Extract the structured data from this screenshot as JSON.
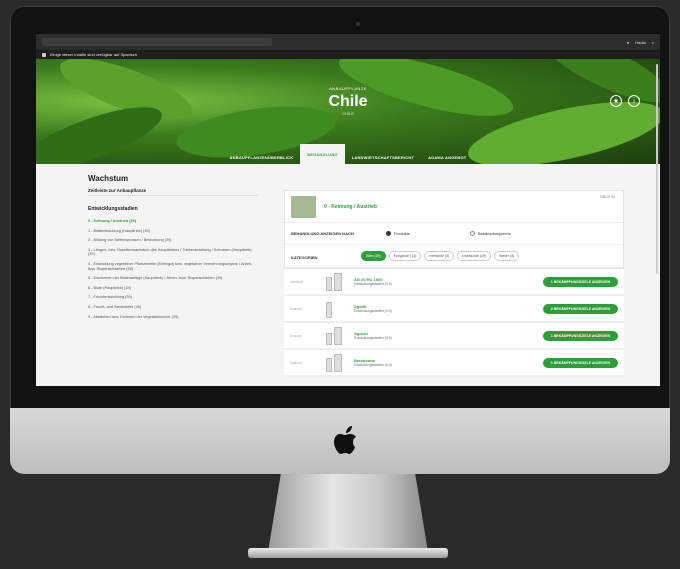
{
  "os_bar": {
    "right_label": "Hadia",
    "search_icon": "search-icon"
  },
  "notice": {
    "text": "Einige dieser Inhalte sind verfügbar auf Spanisch"
  },
  "hero": {
    "kicker": "ANBAUPFLANZE",
    "title": "Chile",
    "subtitle": "CHILE",
    "tabs": [
      {
        "label": "ANBAUPFLANZENÜBERBLICK"
      },
      {
        "label": "BEHANDLUNG"
      },
      {
        "label": "LANDWIRTSCHAFTSBERICHT"
      },
      {
        "label": "ADAMA ANGEBOT"
      }
    ]
  },
  "left": {
    "heading": "Wachstum",
    "timeline_label": "Zeitleiste zur Anbaupflanze",
    "stages_heading": "Entwicklungsstadien",
    "stages": [
      "0 - Keimung / Austrieb (39)",
      "1 - Blattentwicklung (Haupttrieb) (39)",
      "2 - Bildung von Seitensprossen / Bestockung (39)",
      "3 - Längen- bzw. Rosettenwachstum des Haupttriebes / Triebentwicklung / Schossen (Haupttrieb) (39)",
      "4 - Entwicklung vegetativer Pflanzenteile (Erntegut) bzw. vegetativer Vermehrungsorgane / Ähren- bzw. Rispenschwellen (39)",
      "5 - Erscheinen der Blütenanlage (Haupttrieb) / Ähren- bzw. Rispenschieben (39)",
      "6 - Blüte (Haupttrieb) (39)",
      "7 - Fruchtentwicklung (39)",
      "8 - Frucht- und Samenreife (39)",
      "9 - Absterben bzw. Eintreten der Vegetationsruhe (39)"
    ]
  },
  "card": {
    "stage_title": "0 - Keimung / Austrieb",
    "corner_label": "BBCH 00",
    "behandlung_label": "BEHANDLUNG ANZEIGEN NACH",
    "radio_products": "Produkte",
    "radio_targets": "Bekämpfungsziele",
    "categories_label": "KATEGORIEN",
    "chips": [
      "Alles (39)",
      "Fungizide (14)",
      "Herbizide (3)",
      "Insektizide (19)",
      "Weiter (3)"
    ],
    "products": [
      {
        "type": "Insektizid",
        "name": "AG 20 HC 1920",
        "sub": "Entwicklungsstadien (0-9)",
        "button": "1 BEKÄMPFUNGSZIELE ANZEIGEN"
      },
      {
        "type": "Akarizid",
        "name": "Agilith",
        "sub": "Entwicklungsstadien (0-9)",
        "button": "2 BEKÄMPFUNGSZIELE ANZEIGEN"
      },
      {
        "type": "Akarizid",
        "name": "Agrosil",
        "sub": "Entwicklungsstadien (0-9)",
        "button": "1 BEKÄMPFUNGSZIELE ANZEIGEN"
      },
      {
        "type": "Akarizid",
        "name": "Beradouna",
        "sub": "Entwicklungsstadien (0-9)",
        "button": "1 BEKÄMPFUNGSZIELE ANZEIGEN"
      }
    ]
  },
  "colors": {
    "accent": "#2e9e3a",
    "hero_green": "#3a7a1c"
  }
}
